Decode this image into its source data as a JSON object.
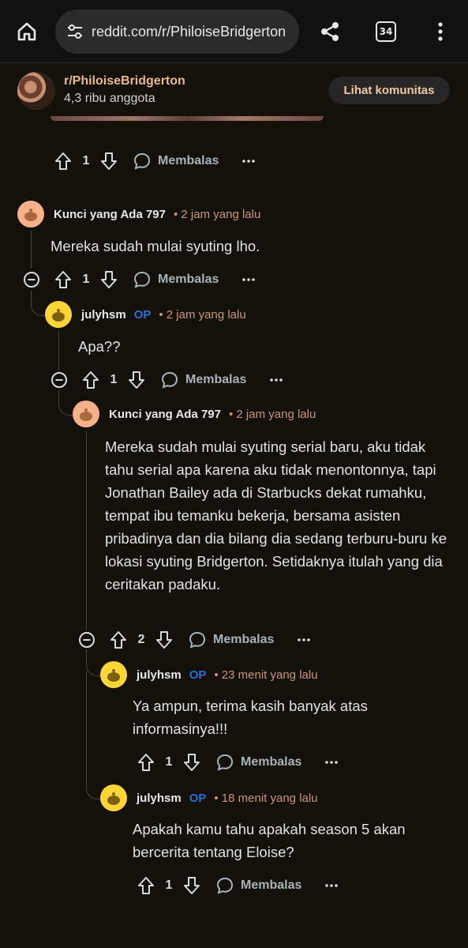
{
  "browser": {
    "url": "reddit.com/r/PhiloiseBridgerton",
    "tab_count": "34"
  },
  "community": {
    "name": "r/PhiloiseBridgerton",
    "members": "4,3 ribu anggota",
    "view_button": "Lihat komunitas"
  },
  "reply_label": "Membalas",
  "post_actions": {
    "score": "1"
  },
  "comments": [
    {
      "username": "Kunci yang Ada 797",
      "op": "",
      "time": "• 2 jam yang lalu",
      "body": "Mereka sudah mulai syuting lho.",
      "score": "1",
      "avatar_color": "#f6b188"
    },
    {
      "username": "julyhsm",
      "op": "OP",
      "time": "• 2 jam yang lalu",
      "body": "Apa??",
      "score": "1",
      "avatar_color": "#ffd635"
    },
    {
      "username": "Kunci yang Ada 797",
      "op": "",
      "time": "• 2 jam yang lalu",
      "body": "Mereka sudah mulai syuting serial baru, aku tidak tahu serial apa karena aku tidak menontonnya, tapi Jonathan Bailey ada di Starbucks dekat rumahku, tempat ibu temanku bekerja, bersama asisten pribadinya dan dia bilang dia sedang terburu-buru ke lokasi syuting Bridgerton. Setidaknya itulah yang dia ceritakan padaku.",
      "score": "2",
      "avatar_color": "#f6b188"
    },
    {
      "username": "julyhsm",
      "op": "OP",
      "time": "• 23 menit yang lalu",
      "body": "Ya ampun, terima kasih banyak atas informasinya!!!",
      "score": "1",
      "avatar_color": "#ffd635"
    },
    {
      "username": "julyhsm",
      "op": "OP",
      "time": "• 18 menit yang lalu",
      "body": "Apakah kamu tahu apakah season 5 akan bercerita tentang Eloise?",
      "score": "1",
      "avatar_color": "#ffd635"
    }
  ]
}
